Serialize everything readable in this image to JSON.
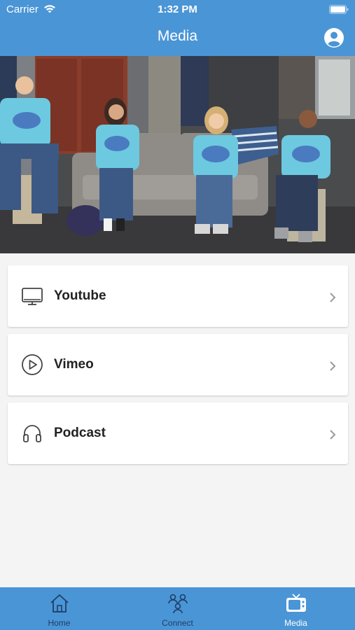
{
  "status_bar": {
    "carrier": "Carrier",
    "time": "1:32 PM"
  },
  "nav": {
    "title": "Media",
    "profile_icon": "user-circle-icon"
  },
  "hero": {
    "description_icon": "hero-photo"
  },
  "menu": {
    "items": [
      {
        "label": "Youtube",
        "icon": "monitor-icon"
      },
      {
        "label": "Vimeo",
        "icon": "play-circle-icon"
      },
      {
        "label": "Podcast",
        "icon": "headphones-icon"
      }
    ]
  },
  "tabbar": {
    "tabs": [
      {
        "label": "Home",
        "icon": "home-icon",
        "active": false
      },
      {
        "label": "Connect",
        "icon": "people-icon",
        "active": false
      },
      {
        "label": "Media",
        "icon": "tv-icon",
        "active": true
      }
    ]
  },
  "colors": {
    "brand_blue": "#4a95d6",
    "inactive_tab": "#1e3f66",
    "background": "#f4f4f4"
  }
}
